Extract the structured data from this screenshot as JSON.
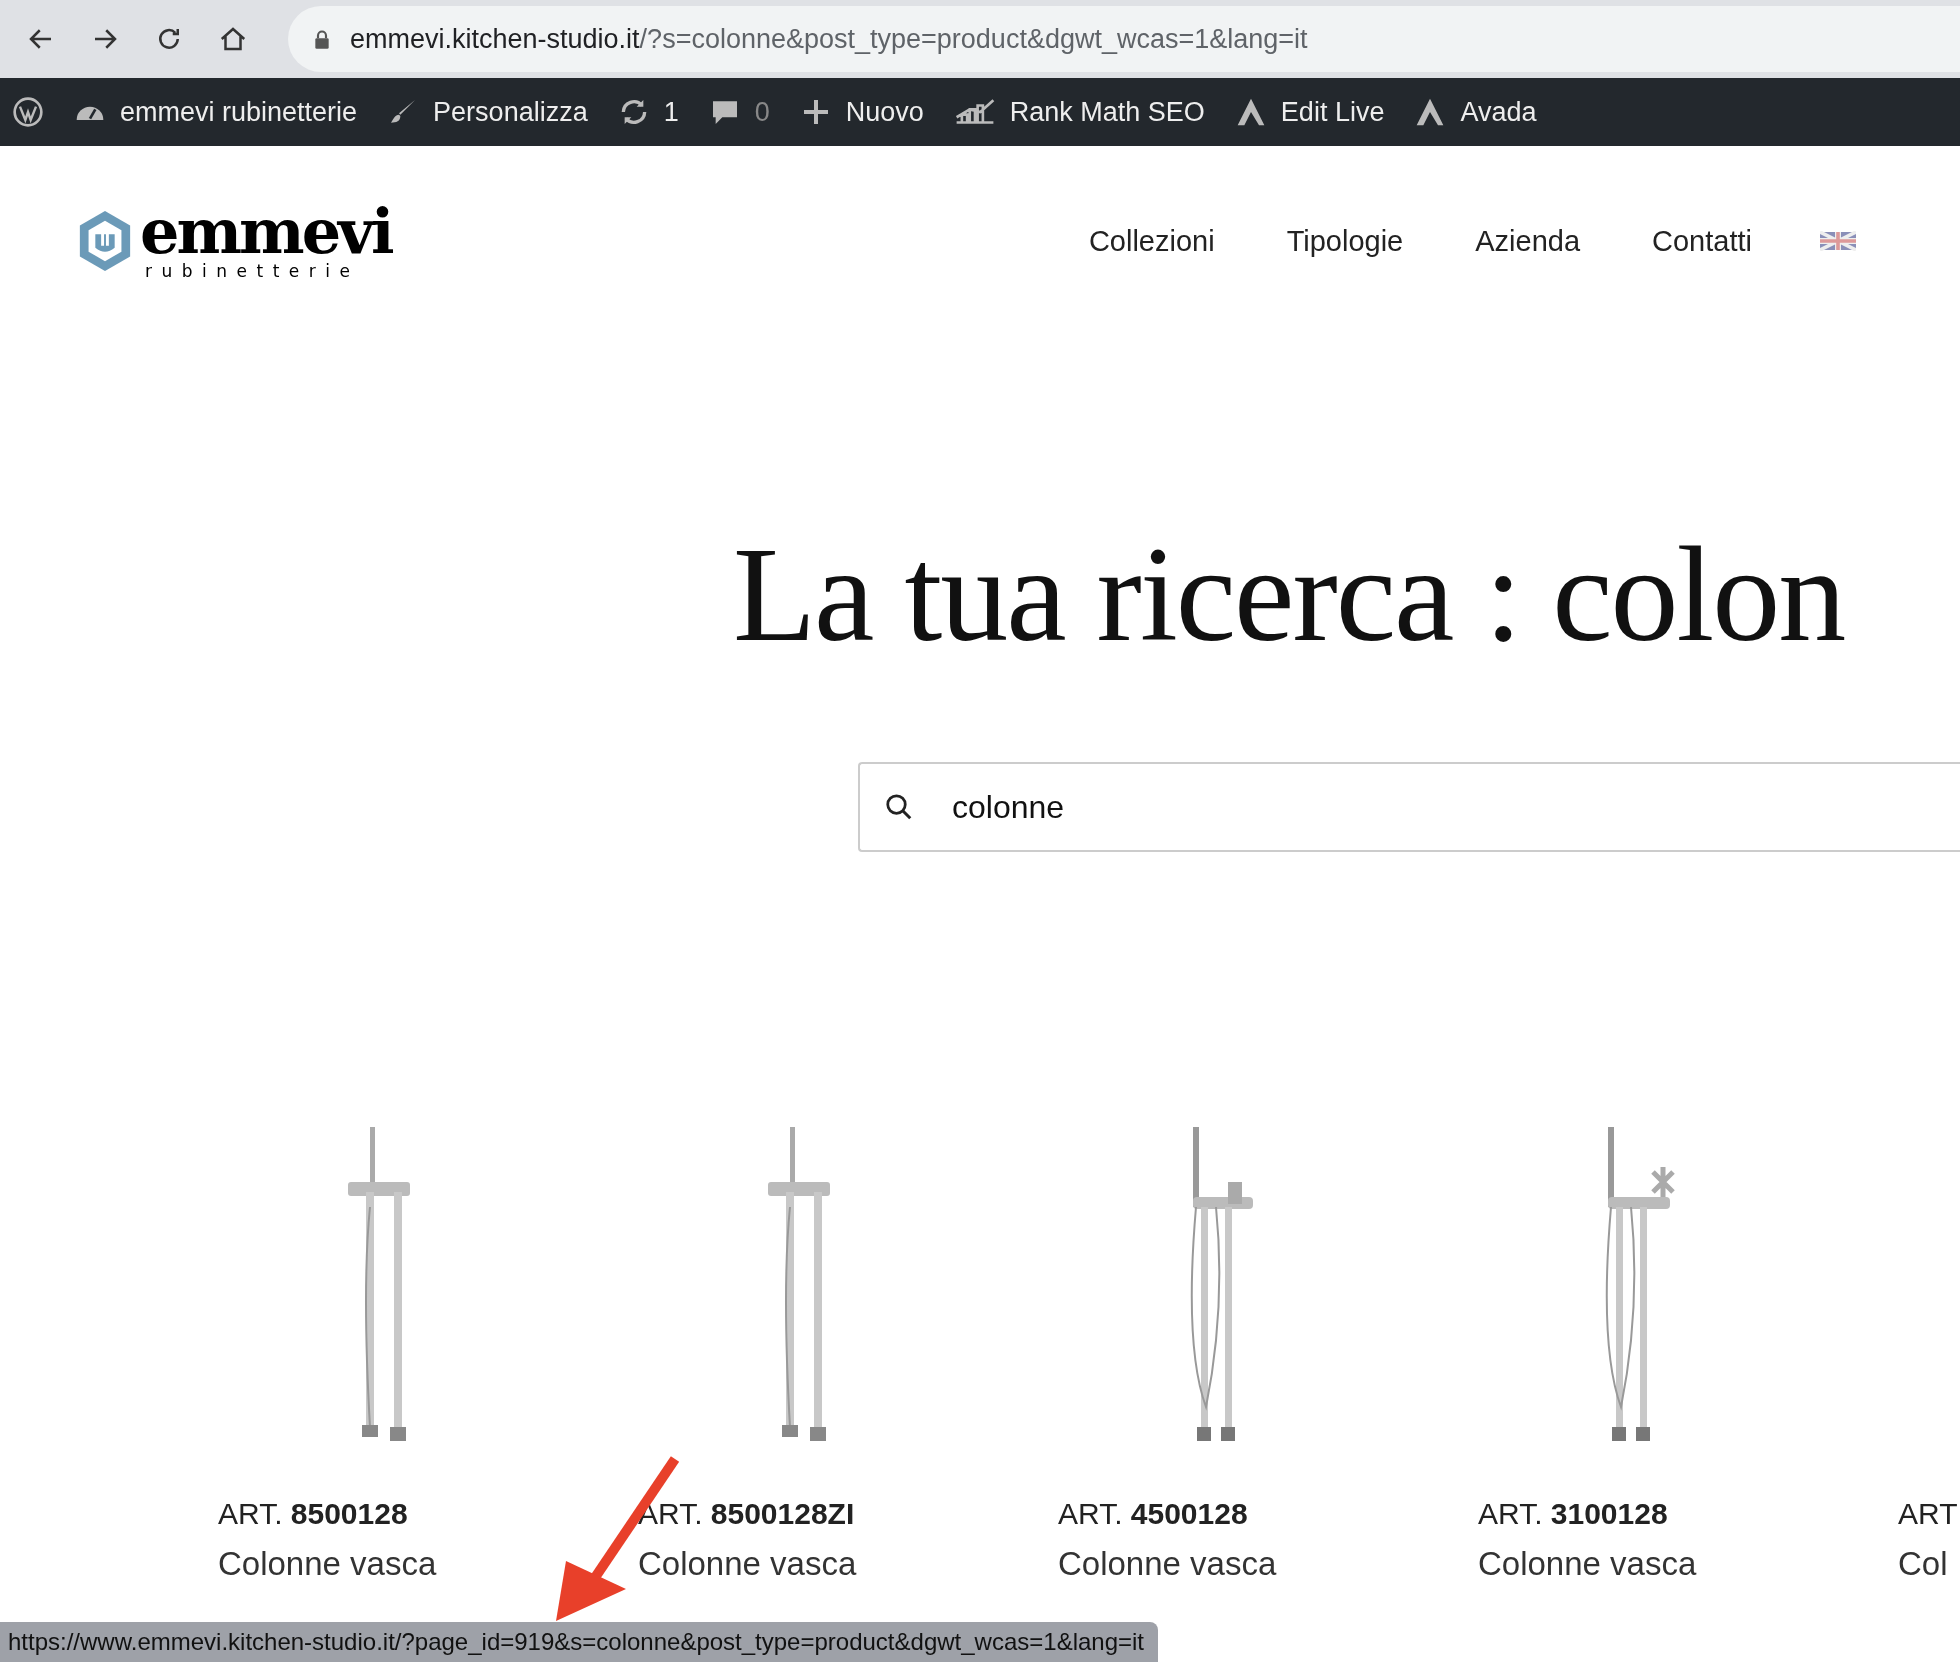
{
  "browser": {
    "url_host": "emmevi.kitchen-studio.it",
    "url_path": "/?s=colonne&post_type=product&dgwt_wcas=1&lang=it"
  },
  "admin_bar": [
    {
      "kind": "wp"
    },
    {
      "kind": "dashboard",
      "label": "emmevi rubinetterie"
    },
    {
      "kind": "brush",
      "label": "Personalizza"
    },
    {
      "kind": "updates",
      "label": "1"
    },
    {
      "kind": "comments",
      "label": "0"
    },
    {
      "kind": "new",
      "label": "Nuovo"
    },
    {
      "kind": "rankmath",
      "label": "Rank Math SEO"
    },
    {
      "kind": "avada",
      "label": "Edit Live"
    },
    {
      "kind": "avada",
      "label": "Avada"
    }
  ],
  "logo": {
    "name": "emmevi",
    "tagline": "rubinetterie"
  },
  "nav": [
    "Collezioni",
    "Tipologie",
    "Azienda",
    "Contatti"
  ],
  "heading": "La tua ricerca : colon",
  "search": {
    "value": "colonne"
  },
  "products": [
    {
      "prefix": "ART.",
      "code": "8500128",
      "name": "Colonne vasca",
      "kind": "straight"
    },
    {
      "prefix": "ART.",
      "code": "8500128ZI",
      "name": "Colonne vasca",
      "kind": "straight"
    },
    {
      "prefix": "ART.",
      "code": "4500128",
      "name": "Colonne vasca",
      "kind": "hose"
    },
    {
      "prefix": "ART.",
      "code": "3100128",
      "name": "Colonne vasca",
      "kind": "cross"
    },
    {
      "prefix": "ART",
      "name": "Col",
      "kind": "none"
    }
  ],
  "status_url": "https://www.emmevi.kitchen-studio.it/?page_id=919&s=colonne&post_type=product&dgwt_wcas=1&lang=it"
}
